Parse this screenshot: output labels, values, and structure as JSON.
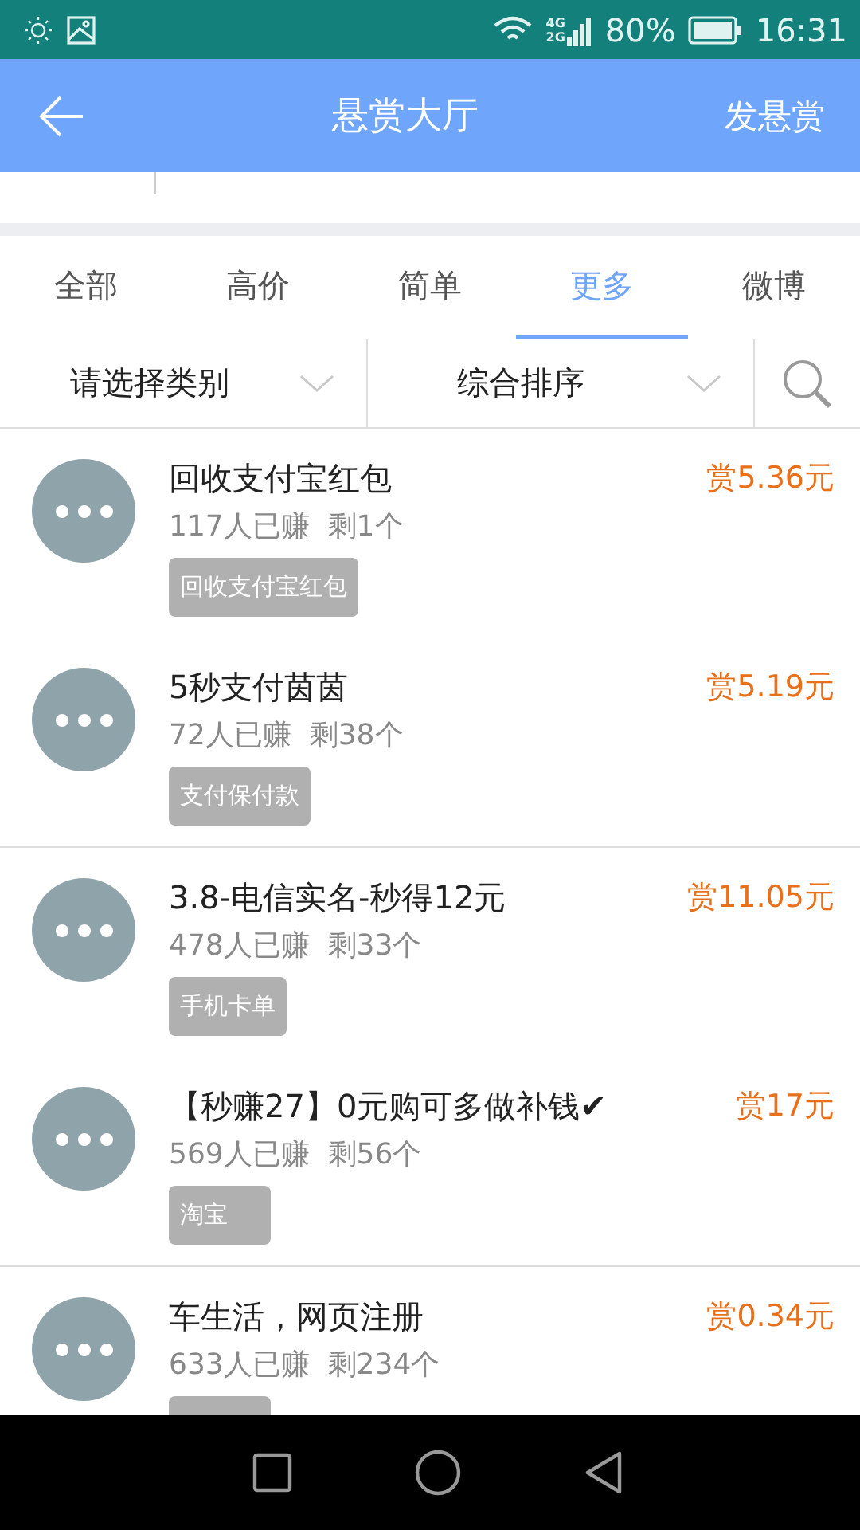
{
  "status_bar": {
    "network": [
      "4G",
      "2G"
    ],
    "battery": "80%",
    "time": "16:31"
  },
  "header": {
    "title": "悬赏大厅",
    "action": "发悬赏"
  },
  "tabs": [
    {
      "label": "全部",
      "selected": false
    },
    {
      "label": "高价",
      "selected": false
    },
    {
      "label": "简单",
      "selected": false
    },
    {
      "label": "更多",
      "selected": true
    },
    {
      "label": "微博",
      "selected": false
    }
  ],
  "filters": [
    {
      "label": "请选择类别"
    },
    {
      "label": "综合排序"
    }
  ],
  "task_groups": [
    [
      {
        "title": "回收支付宝红包",
        "stats": "117人已赚  剩1个",
        "tag": "回收支付宝红包",
        "reward": "赏5.36元"
      },
      {
        "title": "5秒支付茵茵",
        "stats": "72人已赚  剩38个",
        "tag": "支付保付款",
        "reward": "赏5.19元"
      }
    ],
    [
      {
        "title": "3.8-电信实名-秒得12元",
        "stats": "478人已赚  剩33个",
        "tag": "手机卡单",
        "reward": "赏11.05元"
      },
      {
        "title": "【秒赚27】0元购可多做补钱✔",
        "stats": "569人已赚  剩56个",
        "tag": "淘宝",
        "reward": "赏17元"
      }
    ],
    [
      {
        "title": "车生活，网页注册",
        "stats": "633人已赚  剩234个",
        "reward": "赏0.34元"
      }
    ]
  ]
}
